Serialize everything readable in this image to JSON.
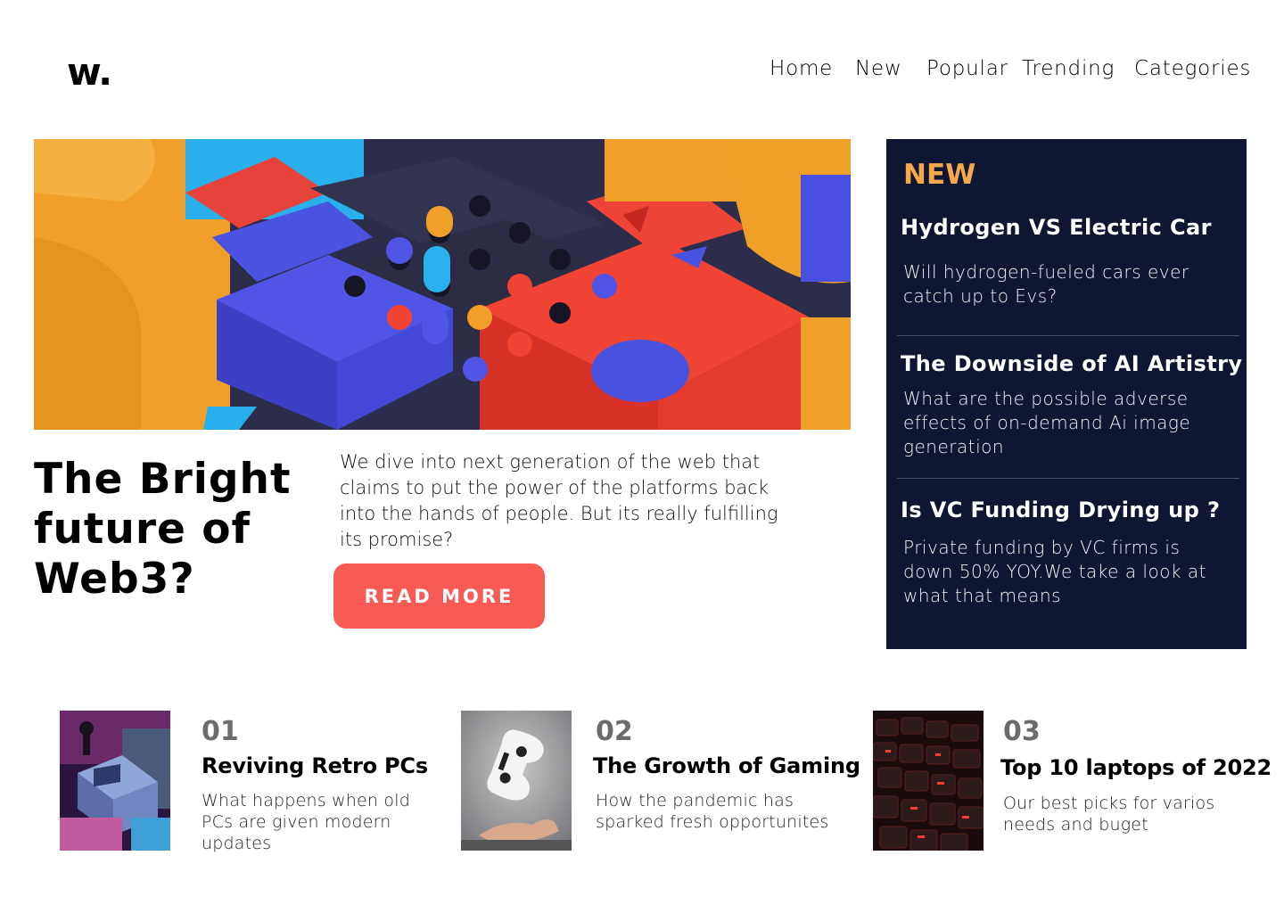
{
  "header": {
    "logo": "w.",
    "nav": [
      "Home",
      "New",
      "Popular",
      "Trending",
      "Categories"
    ]
  },
  "hero": {
    "image": "colorful-3d-blocks-illustration",
    "title": "The Bright future of Web3?",
    "description": "We dive into next generation of the web that claims to put the power of the platforms back into the hands of people. But its really fulfilling its promise?",
    "button": "READ MORE"
  },
  "new_panel": {
    "label": "NEW",
    "items": [
      {
        "title": "Hydrogen VS Electric Car",
        "description": "Will hydrogen-fueled cars ever catch up to Evs?"
      },
      {
        "title": "The Downside of AI Artistry",
        "description": "What are the possible adverse effects of on-demand Ai image generation"
      },
      {
        "title": "Is VC Funding Drying up ?",
        "description": "Private funding by VC firms is down 50% YOY.We take a look at what that means"
      }
    ]
  },
  "articles": [
    {
      "number": "01",
      "title": "Reviving Retro PCs",
      "description": "What happens when old PCs are given modern updates",
      "image": "retro-pc-icon"
    },
    {
      "number": "02",
      "title": "The Growth of Gaming",
      "description": "How the pandemic has sparked fresh opportunites",
      "image": "game-controller-icon"
    },
    {
      "number": "03",
      "title": "Top 10 laptops of 2022",
      "description": "Our best picks for varios needs and buget",
      "image": "laptop-keyboard-icon"
    }
  ],
  "colors": {
    "accent_button": "#f85a55",
    "panel_bg": "#0f1634",
    "new_label": "#f5a94b"
  }
}
